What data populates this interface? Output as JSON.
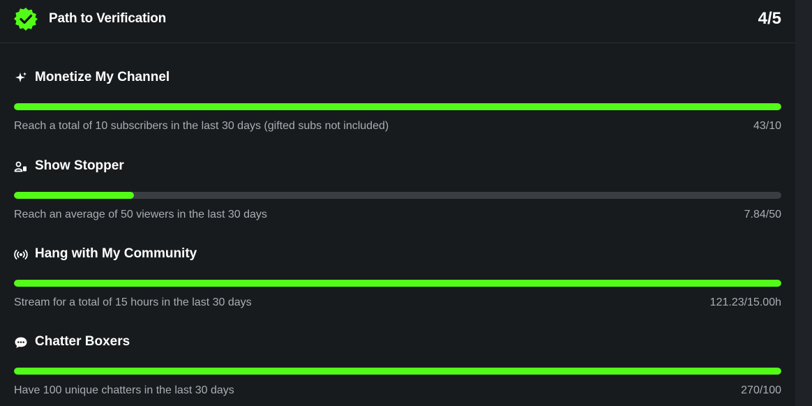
{
  "header": {
    "title": "Path to Verification",
    "count": "4/5",
    "icon": "verified-badge-icon"
  },
  "colors": {
    "accent": "#53fc18",
    "background": "#181b1e",
    "track": "#3a3e43",
    "muted_text": "#a9aeb3"
  },
  "goals": [
    {
      "title": "Monetize My Channel",
      "icon": "sparkle-icon",
      "description": "Reach a total of 10 subscribers in the last 30 days (gifted subs not included)",
      "value": "43/10",
      "progress": 1.0
    },
    {
      "title": "Show Stopper",
      "icon": "viewers-icon",
      "description": "Reach an average of 50 viewers in the last 30 days",
      "value": "7.84/50",
      "progress": 0.1568
    },
    {
      "title": "Hang with My Community",
      "icon": "broadcast-icon",
      "description": "Stream for a total of 15 hours in the last 30 days",
      "value": "121.23/15.00h",
      "progress": 1.0
    },
    {
      "title": "Chatter Boxers",
      "icon": "chat-bubble-icon",
      "description": "Have 100 unique chatters in the last 30 days",
      "value": "270/100",
      "progress": 1.0
    }
  ]
}
